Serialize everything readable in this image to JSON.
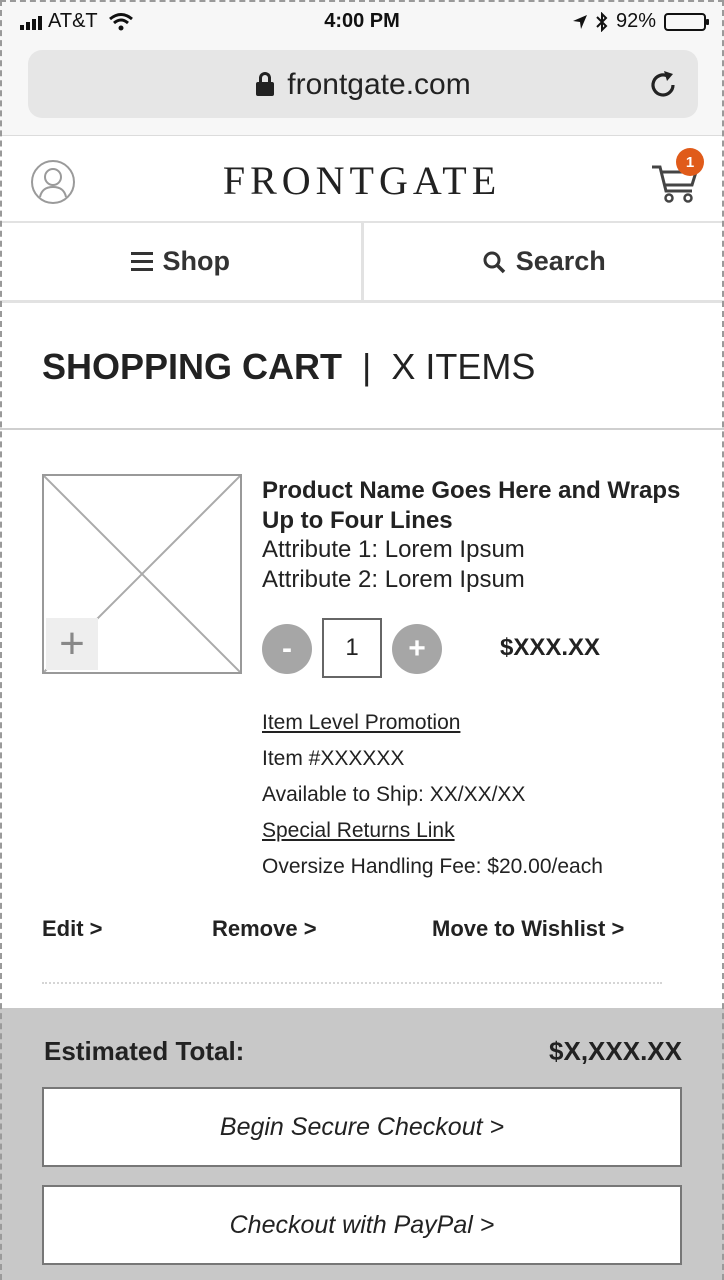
{
  "status_bar": {
    "carrier": "AT&T",
    "time": "4:00 PM",
    "battery": "92%",
    "battery_level": 0.92
  },
  "browser": {
    "url": "frontgate.com"
  },
  "header": {
    "logo": "FRONTGATE",
    "cart_count": "1"
  },
  "nav": {
    "shop_label": "Shop",
    "search_label": "Search"
  },
  "page": {
    "title": "SHOPPING CART",
    "separator": "|",
    "item_count": "X ITEMS"
  },
  "cart_item": {
    "image_zoom_label": "+",
    "name": "Product Name Goes Here and Wraps Up to Four Lines",
    "attribute_1": "Attribute 1: Lorem Ipsum",
    "attribute_2": "Attribute 2: Lorem Ipsum",
    "decrement_label": "-",
    "quantity": "1",
    "increment_label": "+",
    "price": "$XXX.XX",
    "promotion_link": "Item Level Promotion",
    "item_number": "Item #XXXXXX",
    "availability": "Available to Ship: XX/XX/XX",
    "returns_link": "Special Returns Link",
    "handling_fee": "Oversize Handling Fee: $20.00/each",
    "edit_label": "Edit >",
    "remove_label": "Remove >",
    "wishlist_label": "Move to Wishlist >"
  },
  "summary": {
    "total_label": "Estimated Total:",
    "total_value": "$X,XXX.XX",
    "checkout_label": "Begin Secure Checkout >",
    "paypal_label": "Checkout with PayPal >"
  },
  "colors": {
    "badge": "#e05b1a",
    "footer_bg": "#c8c8c8",
    "qty_button": "#a6a6a6"
  }
}
